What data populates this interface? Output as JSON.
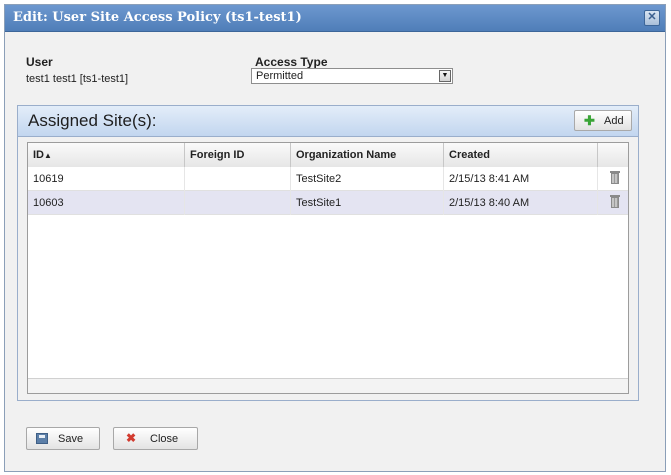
{
  "dialog": {
    "title": "Edit: User Site Access Policy (ts1-test1)",
    "close_icon": "close-icon"
  },
  "form": {
    "user_label": "User",
    "user_value": "test1 test1 [ts1-test1]",
    "access_type_label": "Access Type",
    "access_type_value": "Permitted"
  },
  "assigned_sites": {
    "title": "Assigned Site(s):",
    "add_label": "Add",
    "columns": [
      "ID",
      "Foreign ID",
      "Organization Name",
      "Created",
      ""
    ],
    "sort_column": "ID",
    "sort_direction": "ascending",
    "rows": [
      {
        "id": "10619",
        "foreign_id": "",
        "organization_name": "TestSite2",
        "created": "2/15/13 8:41 AM"
      },
      {
        "id": "10603",
        "foreign_id": "",
        "organization_name": "TestSite1",
        "created": "2/15/13 8:40 AM"
      }
    ]
  },
  "buttons": {
    "save_label": "Save",
    "close_label": "Close"
  },
  "colors": {
    "titlebar": "#5a88c3",
    "panel_header": "#c9dbf1",
    "selected_row": "#e4e4f2",
    "add_icon": "#3aa436",
    "close_icon": "#d23b2f"
  }
}
